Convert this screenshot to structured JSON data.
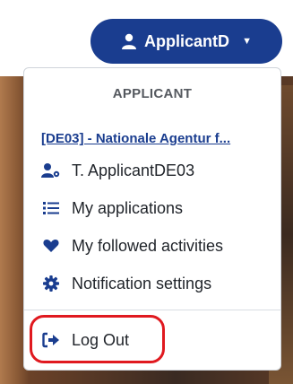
{
  "header": {
    "user_button_label": "ApplicantD"
  },
  "menu": {
    "section_title": "APPLICANT",
    "organization_link": "[DE03] - Nationale Agentur f...",
    "items": [
      {
        "label": "T. ApplicantDE03",
        "icon": "user-gear-icon"
      },
      {
        "label": "My applications",
        "icon": "list-icon"
      },
      {
        "label": "My followed activities",
        "icon": "heart-icon"
      },
      {
        "label": "Notification settings",
        "icon": "gear-icon"
      }
    ],
    "logout_label": "Log Out"
  },
  "colors": {
    "brand": "#1a3d8f",
    "highlight": "#e0191f"
  }
}
